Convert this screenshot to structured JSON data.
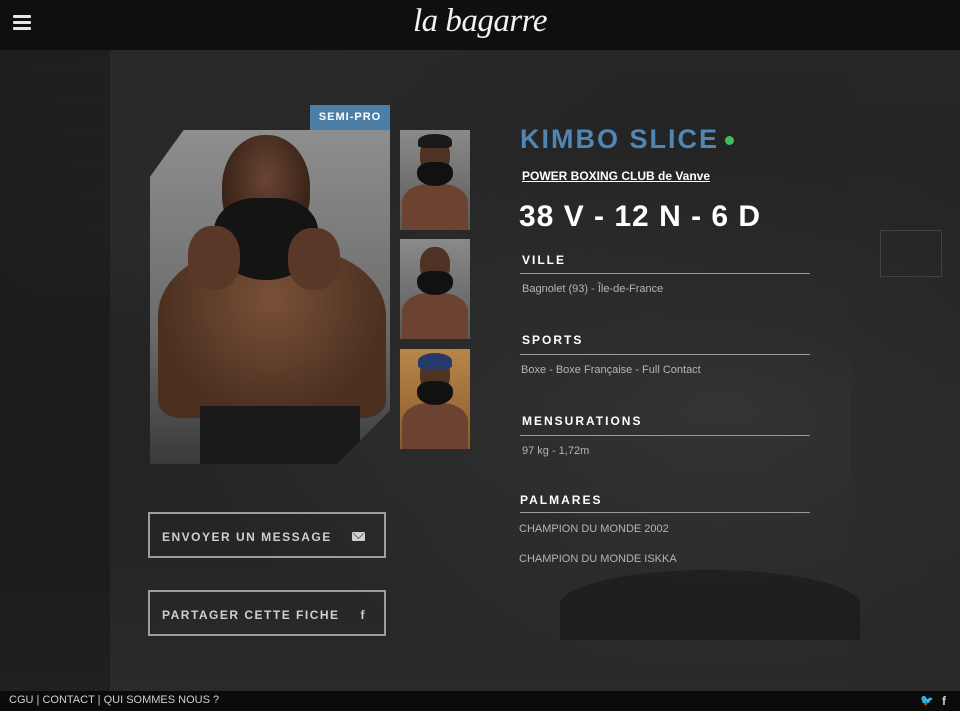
{
  "header": {
    "logo": "la bagarre"
  },
  "fighter": {
    "badge": "SEMI-PRO",
    "name": "KIMBO SLICE",
    "club": "POWER BOXING CLUB de Vanve",
    "record": "38 V - 12 N - 6 D",
    "online_color": "#3fbf57"
  },
  "sections": {
    "ville": {
      "title": "VILLE",
      "text": "Bagnolet (93) - Île-de-France"
    },
    "sports": {
      "title": "SPORTS",
      "text": "Boxe - Boxe Française - Full Contact"
    },
    "mensurations": {
      "title": "MENSURATIONS",
      "text": "97 kg - 1,72m"
    },
    "palmares": {
      "title": "PALMARES",
      "items": [
        "CHAMPION  DU MONDE 2002",
        "CHAMPION DU MONDE ISKKA"
      ]
    }
  },
  "actions": {
    "message": "ENVOYER UN MESSAGE",
    "share": "PARTAGER CETTE FICHE",
    "share_icon": "f"
  },
  "footer": {
    "cgu": "CGU",
    "contact": "CONTACT",
    "about": "QUI SOMMES NOUS ?",
    "sep": "|"
  },
  "social": {
    "twitter": "🐦",
    "facebook": "f"
  },
  "colors": {
    "accent": "#4f86b4",
    "badge": "#4c7ea6"
  }
}
